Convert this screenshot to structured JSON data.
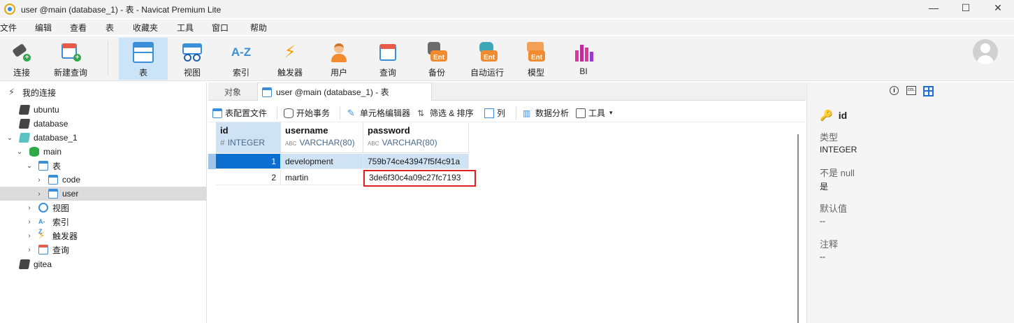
{
  "window": {
    "title": "user @main (database_1) - 表 - Navicat Premium Lite",
    "controls": {
      "minimize": "—",
      "maximize": "☐",
      "close": "✕"
    }
  },
  "menu": [
    "文件",
    "编辑",
    "查看",
    "表",
    "收藏夹",
    "工具",
    "窗口",
    "帮助"
  ],
  "toolbar": {
    "items": [
      {
        "label": "连接",
        "icon": "connection-icon"
      },
      {
        "label": "新建查询",
        "icon": "new-query-icon"
      },
      {
        "label": "表",
        "icon": "table-icon",
        "active": true
      },
      {
        "label": "视图",
        "icon": "view-icon"
      },
      {
        "label": "索引",
        "icon": "index-icon",
        "glyph": "A-Z"
      },
      {
        "label": "触发器",
        "icon": "trigger-icon",
        "glyph": "⚡"
      },
      {
        "label": "用户",
        "icon": "user-icon"
      },
      {
        "label": "查询",
        "icon": "query-icon"
      },
      {
        "label": "备份",
        "icon": "backup-icon",
        "badge": "Ent"
      },
      {
        "label": "自动运行",
        "icon": "automation-icon",
        "badge": "Ent"
      },
      {
        "label": "模型",
        "icon": "model-icon",
        "badge": "Ent"
      },
      {
        "label": "BI",
        "icon": "bi-icon"
      }
    ]
  },
  "sidebar": {
    "root": "我的连接",
    "items": [
      {
        "label": "ubuntu",
        "icon": "connection-icon"
      },
      {
        "label": "database",
        "icon": "connection-icon"
      },
      {
        "label": "database_1",
        "icon": "connection-icon"
      },
      {
        "label": "main",
        "icon": "database-icon"
      },
      {
        "label": "表",
        "icon": "table-folder-icon"
      },
      {
        "label": "code",
        "icon": "table-icon"
      },
      {
        "label": "user",
        "icon": "table-icon",
        "selected": true
      },
      {
        "label": "视图",
        "icon": "view-icon"
      },
      {
        "label": "索引",
        "icon": "index-icon",
        "glyph": "A-Z"
      },
      {
        "label": "触发器",
        "icon": "trigger-icon",
        "glyph": "⚡"
      },
      {
        "label": "查询",
        "icon": "query-icon"
      },
      {
        "label": "gitea",
        "icon": "connection-icon"
      }
    ]
  },
  "tabs": [
    {
      "label": "对象"
    },
    {
      "label": "user @main (database_1) - 表",
      "active": true
    }
  ],
  "object_toolbar": [
    {
      "label": "表配置文件",
      "icon": "table-profile-icon"
    },
    {
      "label": "开始事务",
      "icon": "transaction-icon"
    },
    {
      "label": "单元格编辑器",
      "icon": "cell-editor-icon"
    },
    {
      "label": "筛选 & 排序",
      "icon": "filter-sort-icon"
    },
    {
      "label": "列",
      "icon": "columns-icon"
    },
    {
      "label": "数据分析",
      "icon": "data-analysis-icon"
    },
    {
      "label": "工具",
      "icon": "tools-icon",
      "caret": "▾"
    }
  ],
  "grid": {
    "columns": [
      {
        "name": "id",
        "type": "INTEGER",
        "type_prefix": "#"
      },
      {
        "name": "username",
        "type": "VARCHAR(80)",
        "type_prefix": "ABC"
      },
      {
        "name": "password",
        "type": "VARCHAR(80)",
        "type_prefix": "ABC"
      }
    ],
    "rows": [
      {
        "id": "1",
        "username": "development",
        "password": "759b74ce43947f5f4c91a",
        "selected": true
      },
      {
        "id": "2",
        "username": "martin",
        "password": "3de6f30c4a09c27fc7193",
        "highlighted": true
      }
    ]
  },
  "right_panel": {
    "field_name": "id",
    "type_label": "类型",
    "type_value": "INTEGER",
    "notnull_label": "不是 null",
    "notnull_value": "是",
    "default_label": "默认值",
    "default_value": "--",
    "comment_label": "注释",
    "comment_value": "--",
    "ddl_badge": "DDL"
  },
  "colors": {
    "accent": "#3b8fd9",
    "selected_bg": "#cce4f7",
    "highlight_box": "#e02020",
    "ent_badge": "#f28a2e"
  }
}
